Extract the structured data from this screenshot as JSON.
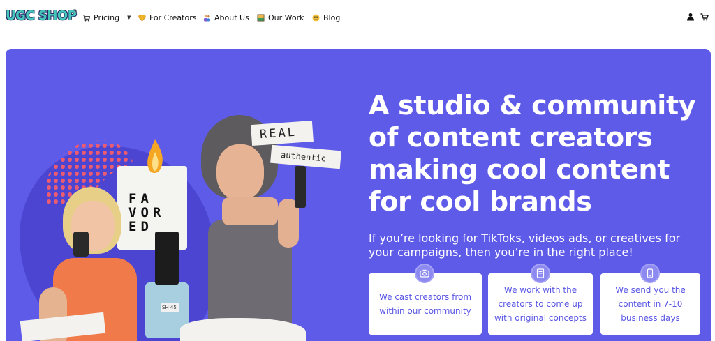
{
  "nav": {
    "logo": "UGC SHOP",
    "items": [
      {
        "label": "Pricing",
        "icon": "cart-icon"
      },
      {
        "label": "For Creators",
        "icon": "heart-icon"
      },
      {
        "label": "About Us",
        "icon": "people-icon"
      },
      {
        "label": "Our Work",
        "icon": "picture-icon"
      },
      {
        "label": "Blog",
        "icon": "sunglasses-face-icon"
      }
    ],
    "right_icons": [
      "account-icon",
      "cart-icon"
    ]
  },
  "hero": {
    "headline": "A studio & community of content creators making cool content for cool brands",
    "subheadline": "If you’re looking for TikToks, videos ads, or creatives for your campaigns, then you’re in the right place!",
    "collage": {
      "note_1": "REAL",
      "note_2": "authentic",
      "candle_label": "FA VOR ED",
      "bottle_label": "SH 45"
    },
    "cards": [
      {
        "text": "We cast creators from within our community",
        "icon": "camera-icon"
      },
      {
        "text": "We work with the creators to come up with original concepts",
        "icon": "document-icon"
      },
      {
        "text": "We send you the content in 7-10 business days",
        "icon": "phone-icon"
      }
    ],
    "colors": {
      "background": "#5f5be9",
      "card_text": "#5a56e4"
    }
  }
}
